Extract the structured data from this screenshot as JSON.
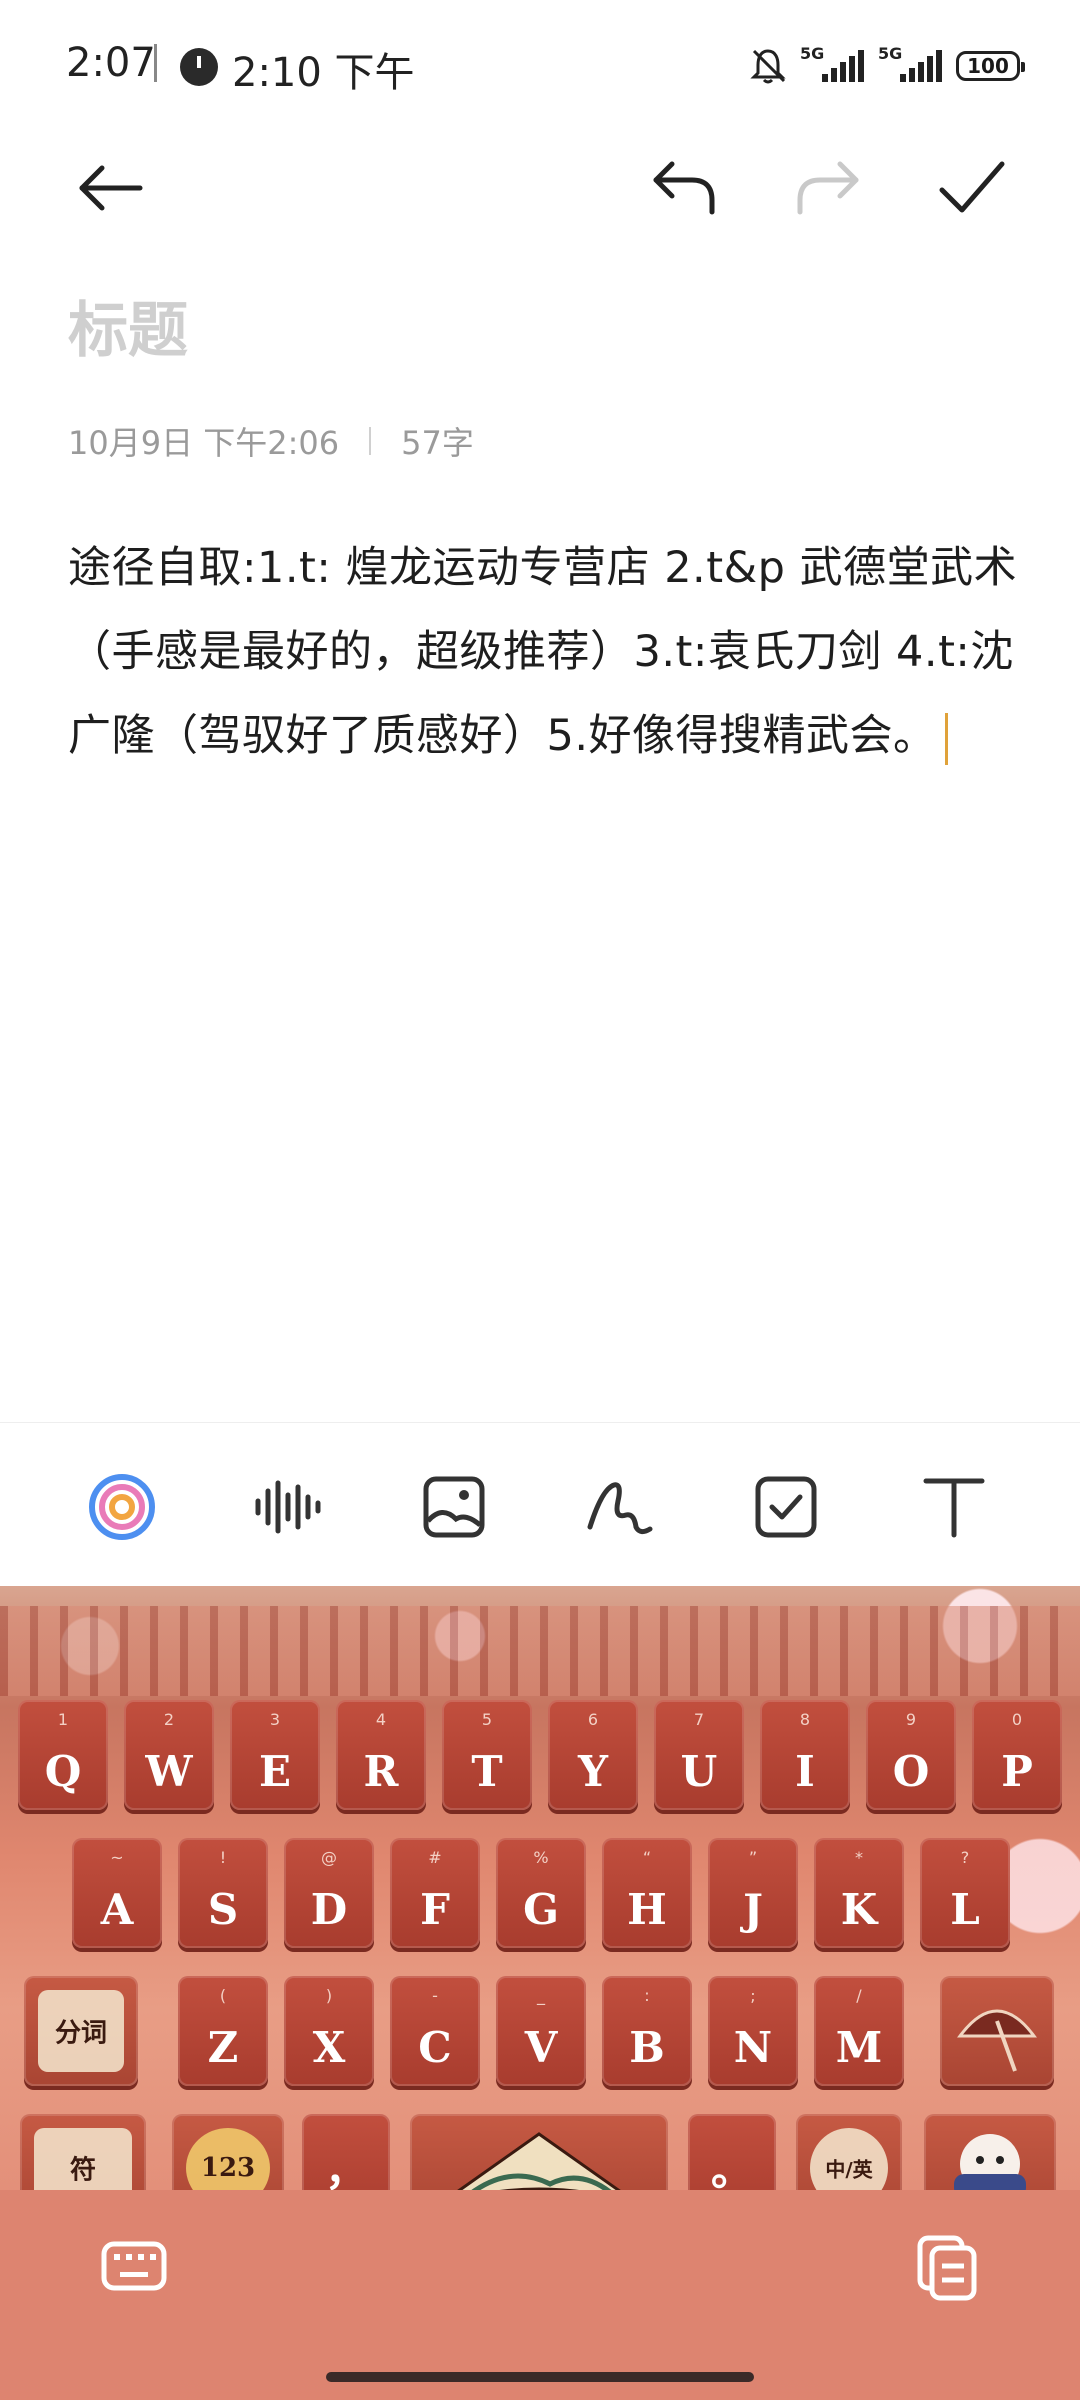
{
  "status_bar": {
    "time": "2:07",
    "alarm_time": "2:10 下午",
    "network_1": "5G",
    "network_2": "5G",
    "battery": "100"
  },
  "toolbar": {
    "icons": [
      "back-arrow-icon",
      "undo-icon",
      "redo-icon",
      "check-icon"
    ]
  },
  "note": {
    "title_placeholder": "标题",
    "date": "10月9日 下午2:06",
    "char_count": "57字",
    "body": "途径自取:1.t: 煌龙运动专营店    2.t&p 武德堂武术（手感是最好的，超级推荐）3.t:袁氏刀剑 4.t:沈广隆（驾驭好了质感好）5.好像得搜精武会。"
  },
  "edit_tools": [
    "ai-assistant-icon",
    "voice-icon",
    "image-icon",
    "handwriting-icon",
    "checklist-icon",
    "text-format-icon"
  ],
  "keyboard": {
    "row1": [
      {
        "main": "Q",
        "sub": "1"
      },
      {
        "main": "W",
        "sub": "2"
      },
      {
        "main": "E",
        "sub": "3"
      },
      {
        "main": "R",
        "sub": "4"
      },
      {
        "main": "T",
        "sub": "5"
      },
      {
        "main": "Y",
        "sub": "6"
      },
      {
        "main": "U",
        "sub": "7"
      },
      {
        "main": "I",
        "sub": "8"
      },
      {
        "main": "O",
        "sub": "9"
      },
      {
        "main": "P",
        "sub": "0"
      }
    ],
    "row2": [
      {
        "main": "A",
        "sub": "~"
      },
      {
        "main": "S",
        "sub": "!"
      },
      {
        "main": "D",
        "sub": "@"
      },
      {
        "main": "F",
        "sub": "#"
      },
      {
        "main": "G",
        "sub": "%"
      },
      {
        "main": "H",
        "sub": "“"
      },
      {
        "main": "J",
        "sub": "”"
      },
      {
        "main": "K",
        "sub": "*"
      },
      {
        "main": "L",
        "sub": "?"
      }
    ],
    "row3": [
      {
        "main": "Z",
        "sub": "("
      },
      {
        "main": "X",
        "sub": ")"
      },
      {
        "main": "C",
        "sub": "-"
      },
      {
        "main": "V",
        "sub": "_"
      },
      {
        "main": "B",
        "sub": ":"
      },
      {
        "main": "N",
        "sub": ";"
      },
      {
        "main": "M",
        "sub": "/"
      }
    ],
    "split_label": "分词",
    "symbols_label": "符",
    "numbers_label": "123",
    "comma_label": "，",
    "period_label": "。",
    "lang_label": "中/英"
  }
}
